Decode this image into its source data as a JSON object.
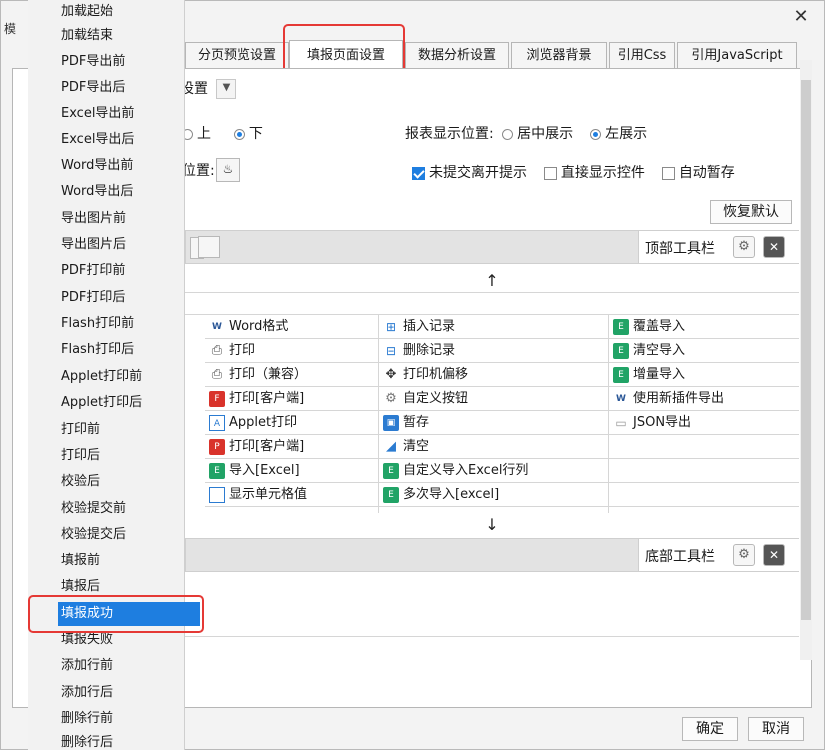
{
  "window": {
    "title_glyph": "模",
    "close_label": "✕"
  },
  "tabs": [
    {
      "label": "分页预览设置",
      "active": false
    },
    {
      "label": "填报页面设置",
      "active": true
    },
    {
      "label": "数据分析设置",
      "active": false
    },
    {
      "label": "浏览器背景",
      "active": false
    },
    {
      "label": "引用Css",
      "active": false
    },
    {
      "label": "引用JavaScript",
      "active": false
    }
  ],
  "settings": {
    "select_value": "设置",
    "position_label_top": "上",
    "position_label_bottom": "下",
    "position_selected": "下",
    "location_label": "位置:",
    "display_label": "报表显示位置:",
    "display_center": "居中展示",
    "display_left": "左展示",
    "display_selected": "左展示",
    "unsaved_tip": "未提交离开提示",
    "unsaved_tip_checked": true,
    "show_controls": "直接显示控件",
    "show_controls_checked": false,
    "auto_save": "自动暂存",
    "auto_save_checked": false,
    "restore_default": "恢复默认"
  },
  "top_toolbar": {
    "label": "顶部工具栏"
  },
  "bottom_toolbar": {
    "label": "底部工具栏"
  },
  "arrows": {
    "up": "↑",
    "down": "↓"
  },
  "toolbar_items": {
    "col1": [
      {
        "label": "Word格式",
        "icon": "word-icon"
      },
      {
        "label": "打印",
        "icon": "printer-icon"
      },
      {
        "label": "打印（兼容）",
        "icon": "printer-icon"
      },
      {
        "label": "打印[客户端]",
        "icon": "flash-print-icon"
      },
      {
        "label": "Applet打印",
        "icon": "applet-print-icon"
      },
      {
        "label": "打印[客户端]",
        "icon": "pdf-print-icon"
      },
      {
        "label": "导入[Excel]",
        "icon": "excel-import-icon"
      },
      {
        "label": "显示单元格值",
        "icon": "cell-value-icon"
      }
    ],
    "col2": [
      {
        "label": "插入记录",
        "icon": "insert-record-icon"
      },
      {
        "label": "删除记录",
        "icon": "delete-record-icon"
      },
      {
        "label": "打印机偏移",
        "icon": "move-icon"
      },
      {
        "label": "自定义按钮",
        "icon": "gear-icon"
      },
      {
        "label": "暂存",
        "icon": "save-icon"
      },
      {
        "label": "清空",
        "icon": "eraser-icon"
      },
      {
        "label": "自定义导入Excel行列",
        "icon": "excel-import-icon"
      },
      {
        "label": "多次导入[excel]",
        "icon": "excel-import-icon"
      }
    ],
    "col3": [
      {
        "label": "覆盖导入",
        "icon": "excel-import-icon"
      },
      {
        "label": "清空导入",
        "icon": "excel-import-icon"
      },
      {
        "label": "增量导入",
        "icon": "excel-import-icon"
      },
      {
        "label": "使用新插件导出",
        "icon": "word-icon"
      },
      {
        "label": "JSON导出",
        "icon": "json-export-icon"
      }
    ]
  },
  "event_menu": [
    "加载起始",
    "加载结束",
    "PDF导出前",
    "PDF导出后",
    "Excel导出前",
    "Excel导出后",
    "Word导出前",
    "Word导出后",
    "导出图片前",
    "导出图片后",
    "PDF打印前",
    "PDF打印后",
    "Flash打印前",
    "Flash打印后",
    "Applet打印前",
    "Applet打印后",
    "打印前",
    "打印后",
    "校验后",
    "校验提交前",
    "校验提交后",
    "填报前",
    "填报后",
    "填报成功",
    "填报失败",
    "添加行前",
    "添加行后",
    "删除行前",
    "删除行后"
  ],
  "event_menu_selected": "填报成功",
  "footer": {
    "ok": "确定",
    "cancel": "取消"
  },
  "colors": {
    "accent": "#1e7ee0",
    "highlight": "#e53935",
    "excel": "#21a366",
    "pdf": "#d9332b",
    "word": "#2b5797"
  }
}
